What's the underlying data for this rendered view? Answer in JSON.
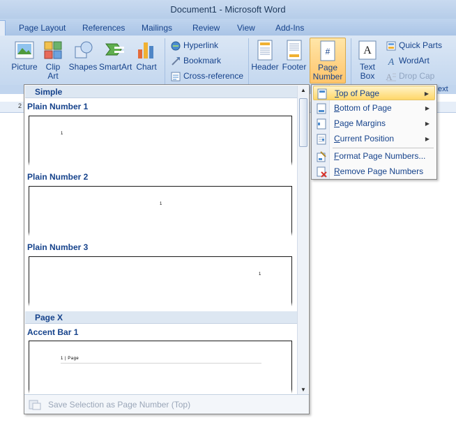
{
  "window": {
    "title": "Document1 - Microsoft Word"
  },
  "tabs": [
    "Page Layout",
    "References",
    "Mailings",
    "Review",
    "View",
    "Add-Ins"
  ],
  "ribbon": {
    "illustrations": [
      {
        "label": "Picture",
        "icon": "picture-icon"
      },
      {
        "label": "Clip\nArt",
        "icon": "clip-art-icon"
      },
      {
        "label": "Shapes",
        "icon": "shapes-icon"
      },
      {
        "label": "SmartArt",
        "icon": "smartart-icon"
      },
      {
        "label": "Chart",
        "icon": "chart-icon"
      }
    ],
    "links": [
      {
        "label": "Hyperlink",
        "icon": "hyperlink-icon"
      },
      {
        "label": "Bookmark",
        "icon": "bookmark-icon"
      },
      {
        "label": "Cross-reference",
        "icon": "cross-reference-icon"
      }
    ],
    "header_footer": [
      {
        "label": "Header",
        "icon": "header-icon"
      },
      {
        "label": "Footer",
        "icon": "footer-icon"
      },
      {
        "label": "Page\nNumber",
        "icon": "page-number-icon"
      }
    ],
    "text": {
      "text_box": "Text\nBox",
      "quick_parts": "Quick Parts",
      "wordart": "WordArt",
      "drop_cap": "Drop Cap",
      "group_caption_partial": "ext"
    }
  },
  "ruler": {
    "mark": "2"
  },
  "gallery": {
    "sections": [
      {
        "header": "Simple",
        "items": [
          {
            "title": "Plain Number 1",
            "sample": "1",
            "align": "left"
          },
          {
            "title": "Plain Number 2",
            "sample": "1",
            "align": "center"
          },
          {
            "title": "Plain Number 3",
            "sample": "1",
            "align": "right"
          }
        ]
      },
      {
        "header": "Page X",
        "items": [
          {
            "title": "Accent Bar 1",
            "sample": "1 | Page",
            "align": "left"
          }
        ]
      }
    ],
    "footer_label": "Save Selection as Page Number (Top)"
  },
  "submenu": {
    "items": [
      {
        "label": "Top of Page",
        "accel": "T",
        "has_arrow": true,
        "active": true,
        "icon": "top-of-page-icon"
      },
      {
        "label": "Bottom of Page",
        "accel": "B",
        "has_arrow": true,
        "active": false,
        "icon": "bottom-of-page-icon"
      },
      {
        "label": "Page Margins",
        "accel": "P",
        "has_arrow": true,
        "active": false,
        "icon": "page-margins-icon"
      },
      {
        "label": "Current Position",
        "accel": "C",
        "has_arrow": true,
        "active": false,
        "icon": "current-position-icon"
      },
      {
        "label": "Format Page Numbers...",
        "accel": "F",
        "has_arrow": false,
        "active": false,
        "icon": "format-page-numbers-icon"
      },
      {
        "label": "Remove Page Numbers",
        "accel": "R",
        "has_arrow": false,
        "active": false,
        "icon": "remove-page-numbers-icon"
      }
    ]
  },
  "colors": {
    "ribbon_text": "#15428b",
    "highlight_top": "#fff3c7",
    "highlight_bottom": "#ffd769",
    "page_number_button": "#ffc46b"
  }
}
